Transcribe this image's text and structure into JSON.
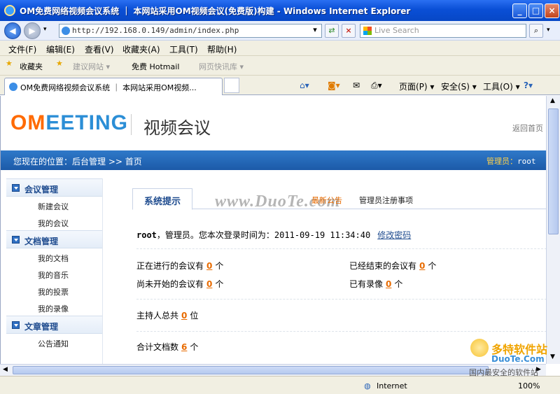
{
  "window": {
    "title": "OM免费网络视频会议系统 ｜ 本网站采用OM视频会议(免费版)构建 - Windows Internet Explorer",
    "minimize": "_",
    "maximize": "□",
    "close": "×"
  },
  "address_bar": {
    "url": "http://192.168.0.149/admin/index.php",
    "search_placeholder": "Live Search"
  },
  "menu": [
    "文件(F)",
    "编辑(E)",
    "查看(V)",
    "收藏夹(A)",
    "工具(T)",
    "帮助(H)"
  ],
  "favorites": {
    "favorites_label": "收藏夹",
    "items": [
      "建议网站 ▾",
      "免费 Hotmail",
      "网页快讯库 ▾"
    ]
  },
  "tab": {
    "title": "OM免费网络视频会议系统 ｜ 本网站采用OM视频..."
  },
  "commands": {
    "page": "页面(P) ▾",
    "safety": "安全(S) ▾",
    "tools": "工具(O) ▾",
    "help": "?▾"
  },
  "site": {
    "logo_o": "OM",
    "logo_rest": "EETING",
    "logo_subtitle": "视频会议",
    "back_home": "返回首页",
    "location": "您现在的位置：后台管理 >> 首页",
    "admin_label": "管理员：",
    "admin_name": "root"
  },
  "sidebar": [
    {
      "title": "会议管理",
      "items": [
        "新建会议",
        "我的会议"
      ]
    },
    {
      "title": "文档管理",
      "items": [
        "我的文档",
        "我的音乐",
        "我的投票",
        "我的录像"
      ]
    },
    {
      "title": "文章管理",
      "items": [
        "公告通知"
      ]
    }
  ],
  "content": {
    "tab_active": "系统提示",
    "tab_latest": "最新公告",
    "tab_notice": "管理员注册事项",
    "watermark": "www.DuoTe.com",
    "welcome_user": "root",
    "welcome_text": "，管理员。您本次登录时间为：",
    "login_time": "2011-09-19 11:34:40",
    "change_password": "修改密码",
    "stats": {
      "ongoing_label": "正在进行的会议有",
      "ongoing_value": "0",
      "ended_label": "已经结束的会议有",
      "ended_value": "0",
      "not_started_label": "尚未开始的会议有",
      "not_started_value": "0",
      "recordings_label": "已有录像",
      "recordings_value": "0",
      "unit_ge": "个",
      "hosts_label": "主持人总共",
      "hosts_value": "0",
      "unit_wei": "位",
      "docs_label": "合计文档数",
      "docs_value": "6"
    }
  },
  "status": {
    "zone": "Internet",
    "zoom": "100%"
  },
  "watermark_corner": {
    "line1": "多特软件站",
    "line2": "DuoTe.Com",
    "line3": "国内最安全的软件站"
  }
}
